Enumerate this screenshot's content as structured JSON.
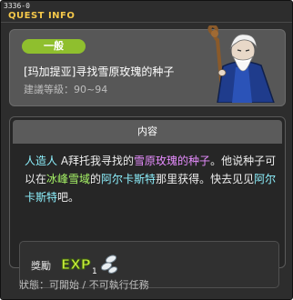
{
  "window": {
    "id_label": "3336-0",
    "title": "QUEST INFO"
  },
  "header": {
    "category": "一般",
    "quest_name": "[玛加提亚]寻找雪原玫瑰的种子",
    "level_text": "建議等級：90~94"
  },
  "body": {
    "section_title": "内容",
    "desc_parts": [
      "人造人",
      " A拜托我寻找的",
      "雪原玫瑰的种子",
      "。他说种子可以在",
      "冰峰雪域",
      "的",
      "阿尔卡斯特",
      "那里获得。快去见见",
      "阿尔卡斯特",
      "吧。"
    ]
  },
  "reward": {
    "label": "獎勵",
    "exp_text": "EXP",
    "item_count": "1"
  },
  "status_text": "狀態：可開始 / 不可執行任務",
  "colors": {
    "accent_yellow": "#f5c84a",
    "badge_green": "#8fbf2e",
    "highlight_pink": "#e78dff",
    "highlight_cyan": "#8ef2ff",
    "highlight_green": "#a6f266"
  }
}
